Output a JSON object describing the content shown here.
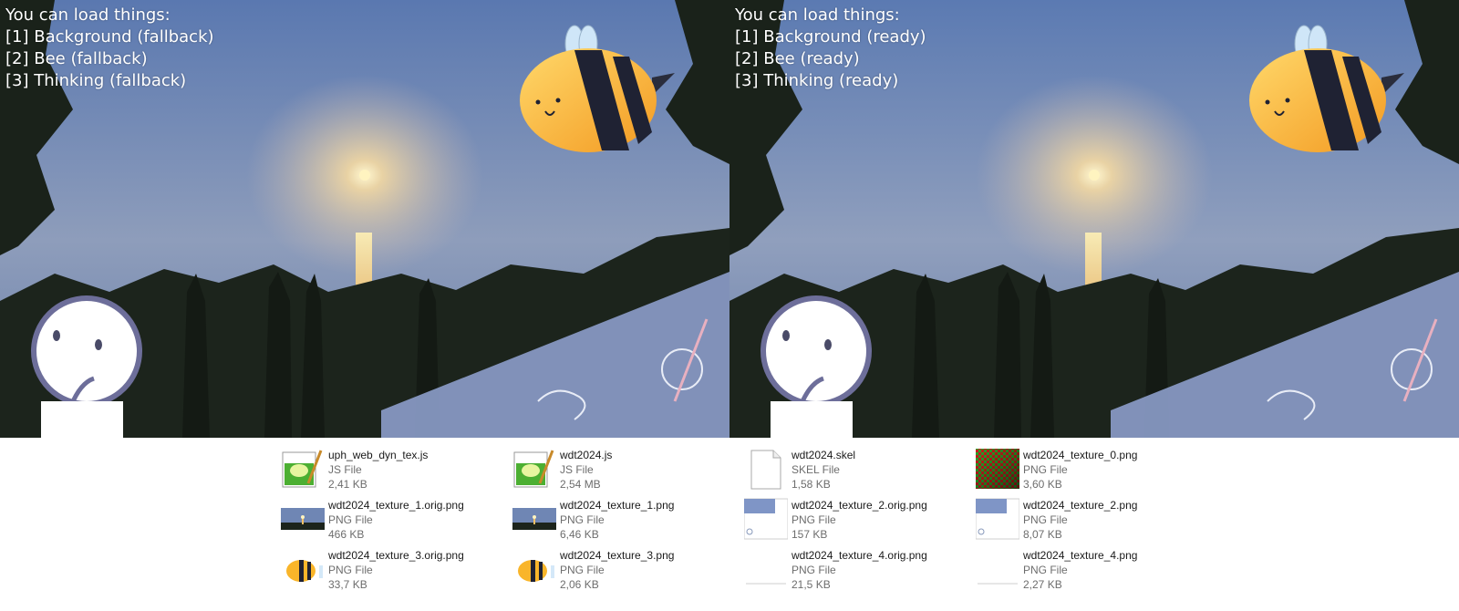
{
  "left_panel": {
    "lines": [
      "You can load things:",
      "[1] Background (fallback)",
      "[2] Bee (fallback)",
      "[3] Thinking (fallback)"
    ]
  },
  "right_panel": {
    "lines": [
      "You can load things:",
      "[1] Background (ready)",
      "[2] Bee (ready)",
      "[3] Thinking (ready)"
    ]
  },
  "files": [
    {
      "name": "uph_web_dyn_tex.js",
      "type": "JS File",
      "size": "2,41 KB",
      "icon": "script-file-icon"
    },
    {
      "name": "wdt2024.js",
      "type": "JS File",
      "size": "2,54 MB",
      "icon": "script-file-icon"
    },
    {
      "name": "wdt2024.skel",
      "type": "SKEL File",
      "size": "1,58 KB",
      "icon": "blank-file-icon"
    },
    {
      "name": "wdt2024_texture_0.png",
      "type": "PNG File",
      "size": "3,60 KB",
      "icon": "checker-texture-thumbnail"
    },
    {
      "name": "wdt2024_texture_1.orig.png",
      "type": "PNG File",
      "size": "466 KB",
      "icon": "sunset-thumbnail"
    },
    {
      "name": "wdt2024_texture_1.png",
      "type": "PNG File",
      "size": "6,46 KB",
      "icon": "sunset-thumbnail"
    },
    {
      "name": "wdt2024_texture_2.orig.png",
      "type": "PNG File",
      "size": "157 KB",
      "icon": "sketch-texture-thumbnail"
    },
    {
      "name": "wdt2024_texture_2.png",
      "type": "PNG File",
      "size": "8,07 KB",
      "icon": "sketch-texture-thumbnail"
    },
    {
      "name": "wdt2024_texture_3.orig.png",
      "type": "PNG File",
      "size": "33,7 KB",
      "icon": "bee-thumbnail"
    },
    {
      "name": "wdt2024_texture_3.png",
      "type": "PNG File",
      "size": "2,06 KB",
      "icon": "bee-thumbnail"
    },
    {
      "name": "wdt2024_texture_4.orig.png",
      "type": "PNG File",
      "size": "21,5 KB",
      "icon": "blank-texture-thumbnail"
    },
    {
      "name": "wdt2024_texture_4.png",
      "type": "PNG File",
      "size": "2,27 KB",
      "icon": "blank-texture-thumbnail"
    }
  ],
  "colors": {
    "sky_top": "#5b79b0",
    "sky_horizon": "#9aa6c0",
    "sea": "#7b8fb2",
    "sun": "#fff4c0",
    "foliage": "#1c241c",
    "bee_yellow": "#f9b52a",
    "bee_stripe": "#1f2233",
    "wing": "#cfe6f8",
    "face_outline": "#6d6e9a",
    "note_paper": "#8a9bc7"
  }
}
